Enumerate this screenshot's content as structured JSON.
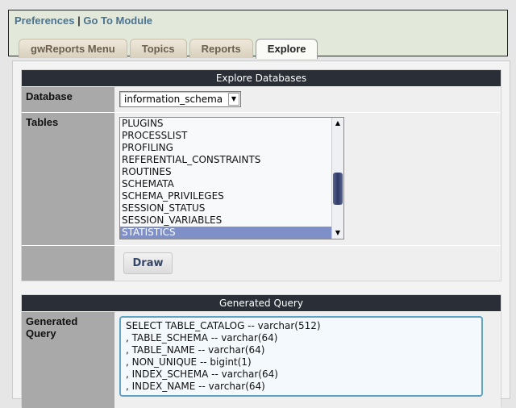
{
  "header": {
    "links": [
      "Preferences",
      "Go To Module"
    ],
    "separator": "|"
  },
  "tabs": [
    {
      "label": "gwReports Menu"
    },
    {
      "label": "Topics"
    },
    {
      "label": "Reports"
    },
    {
      "label": "Explore",
      "active": true
    }
  ],
  "explore": {
    "title": "Explore Databases",
    "database_label": "Database",
    "database_value": "information_schema",
    "tables_label": "Tables",
    "tables": [
      "PLUGINS",
      "PROCESSLIST",
      "PROFILING",
      "REFERENTIAL_CONSTRAINTS",
      "ROUTINES",
      "SCHEMATA",
      "SCHEMA_PRIVILEGES",
      "SESSION_STATUS",
      "SESSION_VARIABLES",
      "STATISTICS"
    ],
    "selected_table": "STATISTICS",
    "draw_label": "Draw"
  },
  "query": {
    "title": "Generated Query",
    "label": "Generated Query",
    "lines": [
      "SELECT TABLE_CATALOG -- varchar(512)",
      ", TABLE_SCHEMA -- varchar(64)",
      ", TABLE_NAME -- varchar(64)",
      ", NON_UNIQUE -- bigint(1)",
      ", INDEX_SCHEMA -- varchar(64)",
      ", INDEX_NAME -- varchar(64)"
    ]
  }
}
